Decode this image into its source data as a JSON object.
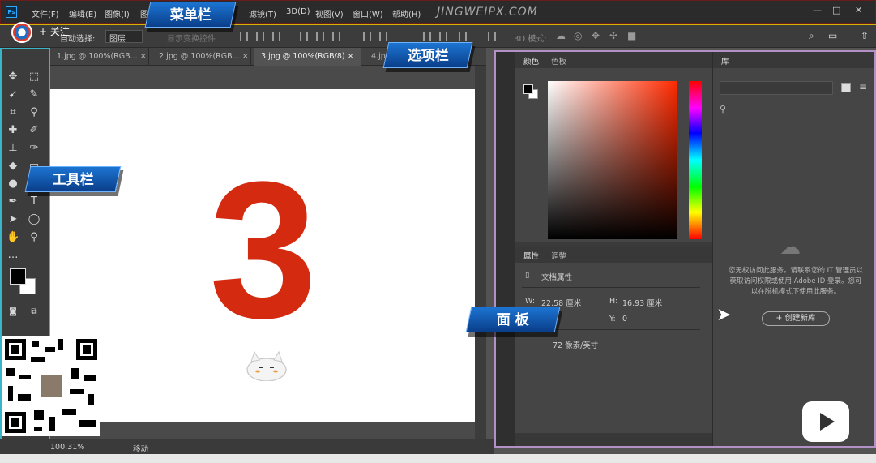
{
  "menubar": {
    "logo": "Ps",
    "items": [
      "文件(F)",
      "编辑(E)",
      "图像(I)",
      "图",
      "滤镜(T)",
      "3D(D)",
      "视图(V)",
      "窗口(W)",
      "帮助(H)"
    ],
    "watermark": "JINGWEIPX.COM",
    "window_controls": [
      "—",
      "□",
      "✕"
    ]
  },
  "follow": {
    "label": "+ 关注"
  },
  "options": {
    "auto_select_label": "自动选择:",
    "auto_select_value": "图层",
    "transform_label": "显示变换控件",
    "mode_3d_label": "3D 模式:"
  },
  "tabs": [
    {
      "label": "1.jpg @ 100%(RGB...",
      "close": "×"
    },
    {
      "label": "2.jpg @ 100%(RGB...",
      "close": "×"
    },
    {
      "label": "3.jpg @ 100%(RGB/8)",
      "close": "×"
    },
    {
      "label": "4.jpg",
      "close": ""
    }
  ],
  "canvas": {
    "number": "3"
  },
  "status": {
    "zoom": "100.31%",
    "tool": "移动"
  },
  "color_panel": {
    "tabs": [
      "颜色",
      "色板"
    ]
  },
  "properties_panel": {
    "tabs": [
      "属性",
      "调整"
    ],
    "doc_title": "文档属性",
    "width_label": "W:",
    "width_value": "22.58 厘米",
    "height_label": "H:",
    "height_value": "16.93 厘米",
    "y_label": "Y:",
    "y_value": "0",
    "resolution": "72 像素/英寸"
  },
  "library_panel": {
    "tab": "库",
    "message": "您无权访问此服务。请联系您的 IT 管理员以获取访问权限或使用 Adobe ID 登录。您可以在脱机模式下使用此服务。",
    "create_button": "+ 创建新库"
  },
  "callouts": {
    "menubar": "菜单栏",
    "optionsbar": "选项栏",
    "toolbar": "工具栏",
    "panels": "面 板"
  },
  "colors": {
    "accent_number": "#d42a10",
    "callout_blue": "#1c74d2",
    "toolbar_outline": "#3ab5c8",
    "panel_outline": "#b391c7",
    "options_outline": "#d4b400"
  }
}
